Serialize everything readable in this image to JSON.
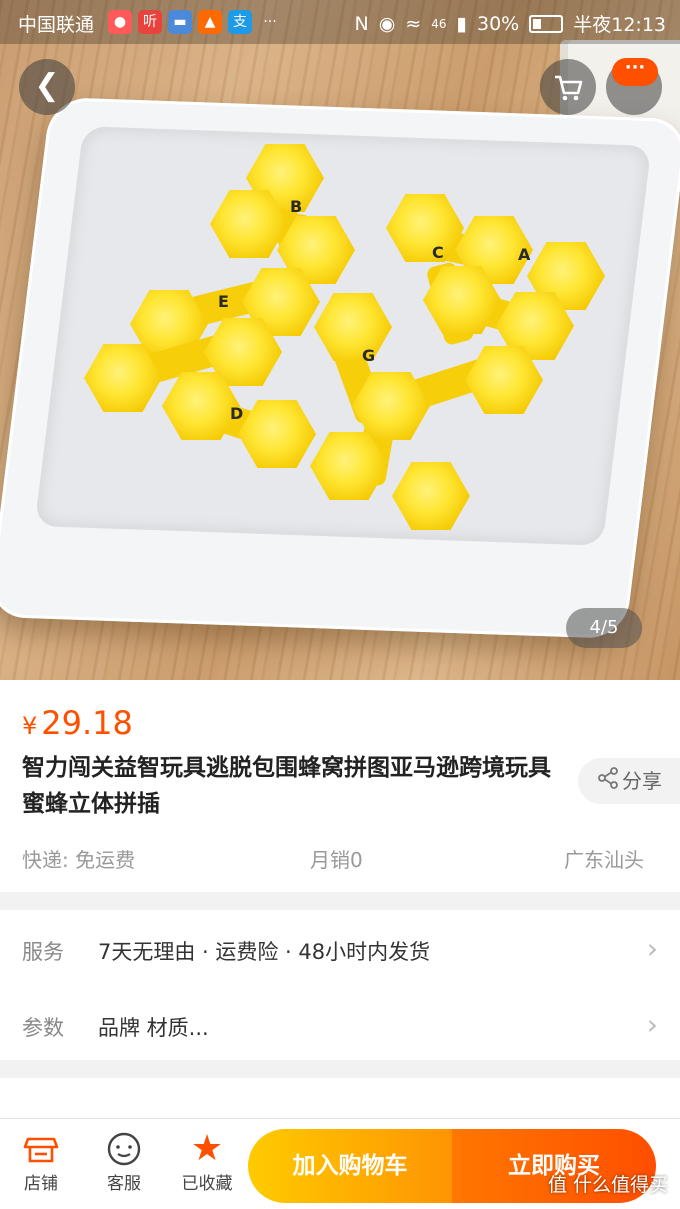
{
  "status_bar": {
    "carrier": "中国联通",
    "app_badges": [
      "听",
      "支"
    ],
    "network": "46",
    "battery": "30%",
    "time": "半夜12:13"
  },
  "gallery": {
    "counter": "4/5"
  },
  "product": {
    "currency": "¥",
    "price": "29.18",
    "title": "智力闯关益智玩具逃脱包围蜂窝拼图亚马逊跨境玩具 蜜蜂立体拼插",
    "share_label": "分享",
    "shipping": "快递: 免运费",
    "monthly_sales": "月销0",
    "location": "广东汕头"
  },
  "service": {
    "label": "服务",
    "value": "7天无理由 · 运费险 · 48小时内发货"
  },
  "params": {
    "label": "参数",
    "value": "品牌 材质..."
  },
  "bottom_bar": {
    "store": "店铺",
    "service": "客服",
    "favorite": "已收藏",
    "add_to_cart": "加入购物车",
    "buy_now": "立即购买"
  },
  "watermark": "值 什么值得买",
  "puzzle_letters": [
    "B",
    "A",
    "C",
    "E",
    "G",
    "D"
  ],
  "colors": {
    "accent": "#ff5000",
    "cart_button": "#ff9402",
    "piece_yellow": "#ffe633"
  },
  "icons": [
    "back-arrow-icon",
    "cart-icon",
    "more-icon",
    "share-icon",
    "store-icon",
    "service-icon",
    "star-icon",
    "chevron-right-icon"
  ]
}
